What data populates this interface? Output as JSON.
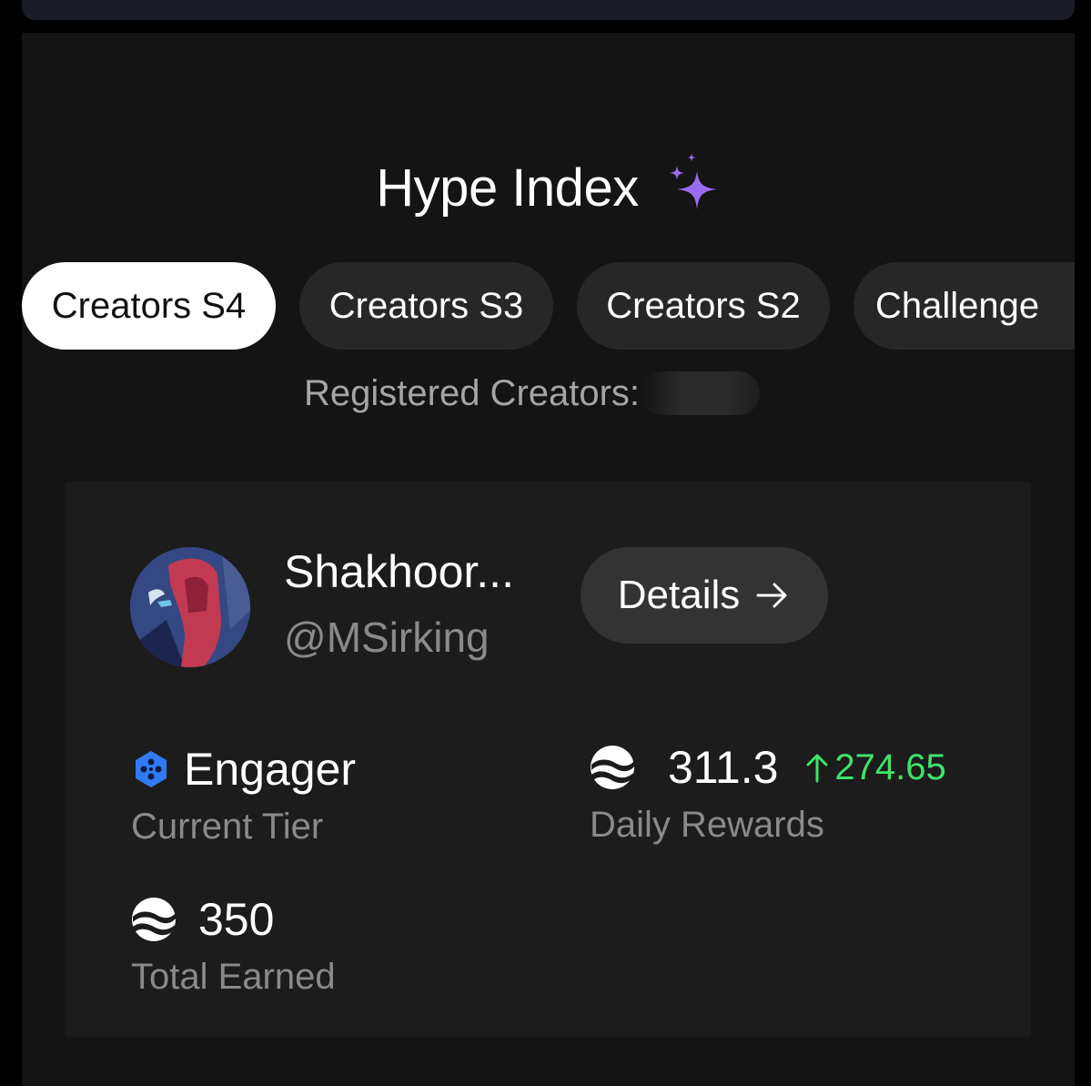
{
  "page": {
    "title": "Hype Index"
  },
  "tabs": [
    {
      "label": "Creators S4",
      "active": true
    },
    {
      "label": "Creators S3",
      "active": false
    },
    {
      "label": "Creators S2",
      "active": false
    },
    {
      "label": "Challenge",
      "active": false
    }
  ],
  "registered": {
    "label": "Registered Creators:"
  },
  "profile": {
    "name": "Shakhoor...",
    "handle": "@MSirking",
    "details_label": "Details"
  },
  "stats": {
    "tier_value": "Engager",
    "tier_label": "Current Tier",
    "daily_value": "311.3",
    "daily_change": "274.65",
    "daily_label": "Daily Rewards",
    "total_value": "350",
    "total_label": "Total Earned"
  },
  "icons": {
    "title": "sparkle-icon",
    "details": "arrow-right-icon",
    "tier": "hexagon-badge-icon",
    "reward": "coin-icon",
    "change": "arrow-up-icon"
  },
  "colors": {
    "background": "#141414",
    "card": "#1c1c1c",
    "accent_purple": "#9b6cf0",
    "positive_green": "#3ee46a",
    "tier_blue": "#2f7bf5"
  }
}
